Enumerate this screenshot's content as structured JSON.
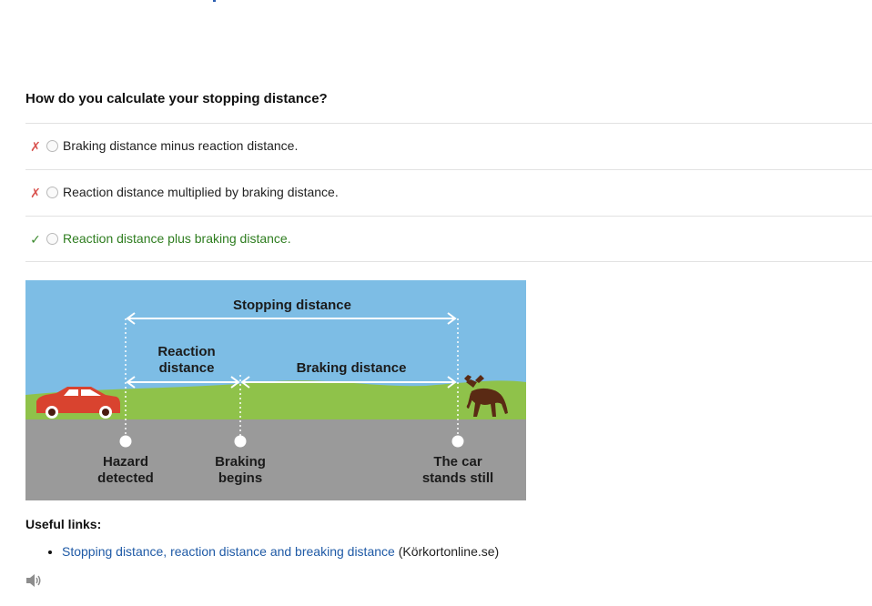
{
  "question": "How do you calculate your stopping distance?",
  "answers": [
    {
      "mark": "✗",
      "text": "Braking distance minus reaction distance.",
      "correct": false
    },
    {
      "mark": "✗",
      "text": "Reaction distance multiplied by braking distance.",
      "correct": false
    },
    {
      "mark": "✓",
      "text": "Reaction distance plus braking distance.",
      "correct": true
    }
  ],
  "illustration": {
    "stopping_distance": "Stopping distance",
    "reaction_line1": "Reaction",
    "reaction_line2": "distance",
    "braking_distance": "Braking distance",
    "hazard_line1": "Hazard",
    "hazard_line2": "detected",
    "braking_line1": "Braking",
    "braking_line2": "begins",
    "still_line1": "The car",
    "still_line2": "stands still",
    "colors": {
      "sky": "#7dbde5",
      "grass": "#8fc24a",
      "road": "#9a9a9a",
      "car": "#d9432f",
      "moose": "#5a2a14"
    }
  },
  "useful_links": {
    "heading": "Useful links:",
    "items": [
      {
        "link_text": "Stopping distance, reaction distance and breaking distance",
        "source": " (Körkortonline.se)"
      }
    ]
  },
  "icons": {
    "audio": "speaker-icon"
  }
}
